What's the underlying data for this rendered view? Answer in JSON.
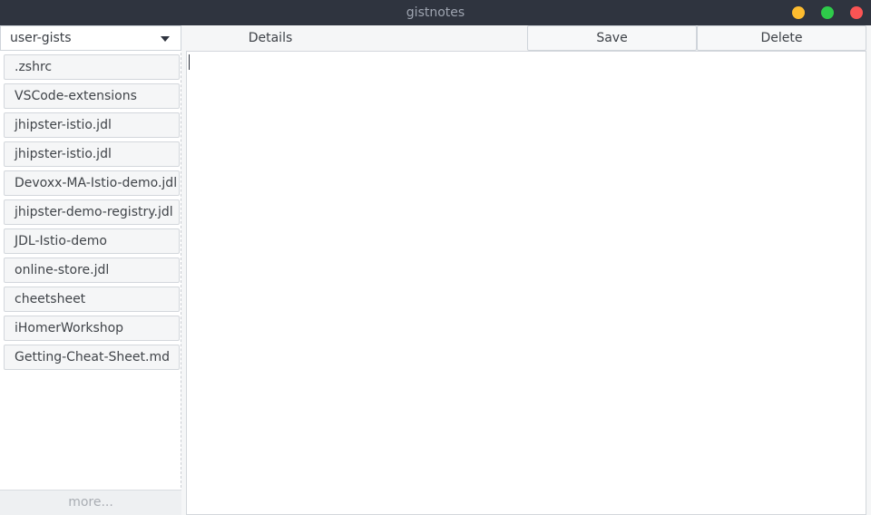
{
  "window": {
    "title": "gistnotes",
    "controls": {
      "minimize_color": "#fdbc2f",
      "maximize_color": "#2ecb4a",
      "close_color": "#fb5454"
    }
  },
  "sidebar": {
    "selector": {
      "value": "user-gists"
    },
    "items": [
      {
        "label": ".zshrc"
      },
      {
        "label": "VSCode-extensions"
      },
      {
        "label": "jhipster-istio.jdl"
      },
      {
        "label": "jhipster-istio.jdl"
      },
      {
        "label": "Devoxx-MA-Istio-demo.jdl"
      },
      {
        "label": "jhipster-demo-registry.jdl"
      },
      {
        "label": "JDL-Istio-demo"
      },
      {
        "label": "online-store.jdl"
      },
      {
        "label": "cheetsheet"
      },
      {
        "label": "iHomerWorkshop"
      },
      {
        "label": "Getting-Cheat-Sheet.md"
      }
    ],
    "more_label": "more..."
  },
  "main": {
    "details_label": "Details",
    "save_label": "Save",
    "delete_label": "Delete",
    "editor_value": ""
  }
}
